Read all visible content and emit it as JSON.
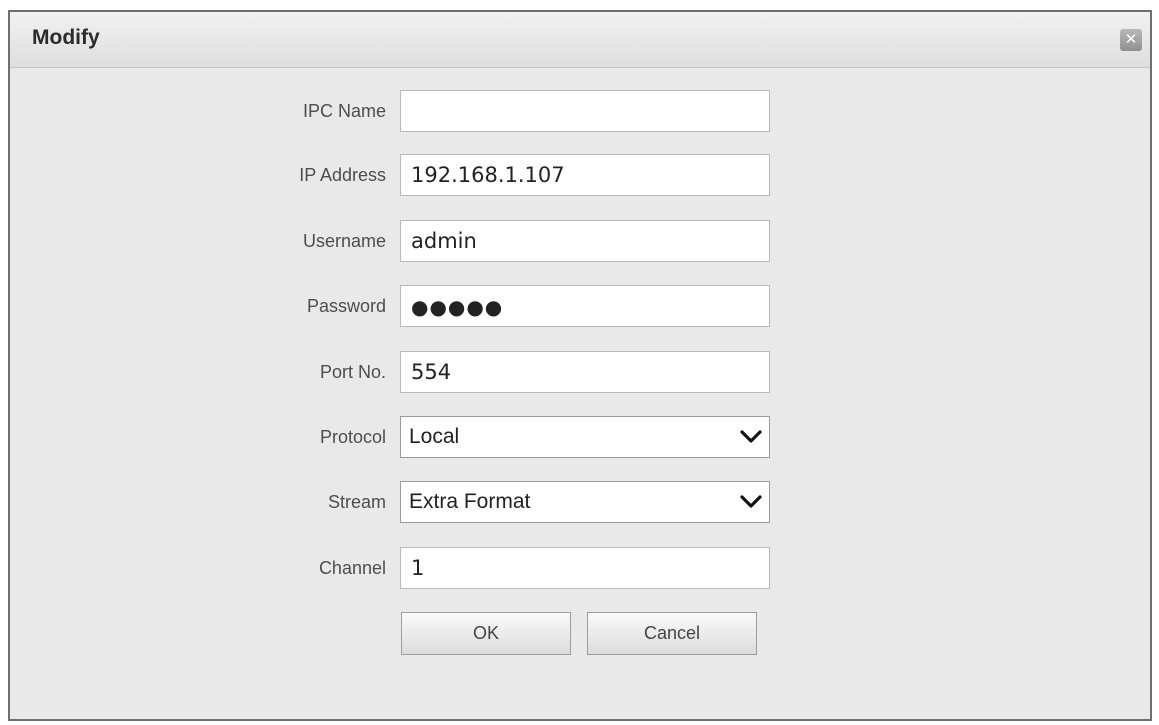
{
  "dialog": {
    "title": "Modify",
    "close_icon": "close-icon"
  },
  "form": {
    "ipc_name": {
      "label": "IPC Name",
      "value": ""
    },
    "ip_address": {
      "label": "IP Address",
      "value": "192.168.1.107"
    },
    "username": {
      "label": "Username",
      "value": "admin"
    },
    "password": {
      "label": "Password",
      "masked": "●●●●●"
    },
    "port": {
      "label": "Port No.",
      "value": "554"
    },
    "protocol": {
      "label": "Protocol",
      "selected": "Local"
    },
    "stream": {
      "label": "Stream",
      "selected": "Extra Format"
    },
    "channel": {
      "label": "Channel",
      "value": "1"
    }
  },
  "buttons": {
    "ok": "OK",
    "cancel": "Cancel"
  },
  "icons": {
    "dropdown": "chevron-down-icon"
  }
}
